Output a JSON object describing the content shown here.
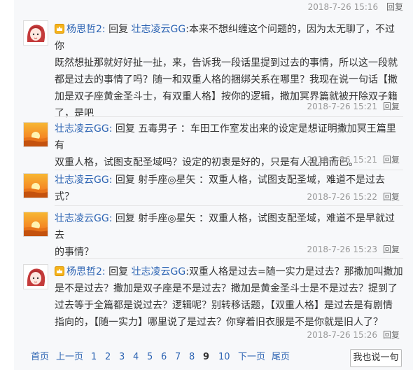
{
  "top_meta": {
    "time": "2018-7-26 15:16",
    "reply_label": "回复"
  },
  "replies": [
    {
      "user": "杨思哲2:",
      "reply_word": "回复",
      "target": "壮志凌云GG",
      "text_lines": [
        ":本来不想纠缠这个问题的，因为太无聊了，不过你",
        "既然想扯那就好好扯一扯，来，告诉我一段话里提到过去的事情，所以这一段就",
        "都是过去的事情了吗？随一和双重人格的捆绑关系在哪里？我现在说一句话【撒",
        "加是双子座黄金圣斗士，有双重人格】按你的逻辑，撒加冥界篇就被开除双子籍",
        "了，是吧"
      ],
      "time": "2018-7-26 15:21",
      "reply_label": "回复"
    },
    {
      "user": "壮志凌云GG:",
      "reply_word": "回复",
      "target": "五毒男子",
      "text_lines": [
        "：车田工作室发出来的设定是想证明撒加冥王篇里有",
        "双重人格，试图支配圣域吗？设定的初衷是好的，只是有人乱用而已。"
      ],
      "time": "2018-7-26 15:21",
      "reply_label": "回复"
    },
    {
      "user": "壮志凌云GG:",
      "reply_word": "回复",
      "target": "射手座◎星矢",
      "text_lines": [
        "：双重人格，试图支配圣域，难道不是过去式？"
      ],
      "time": "2018-7-26 15:22",
      "reply_label": "回复"
    },
    {
      "user": "壮志凌云GG:",
      "reply_word": "回复",
      "target": "射手座◎星矢",
      "text_lines": [
        "：双重人格，试图支配圣域，难道不是早就过去",
        "的事情？"
      ],
      "time": "2018-7-26 15:23",
      "reply_label": "回复"
    },
    {
      "user": "杨思哲2:",
      "reply_word": "回复",
      "target": "壮志凌云GG",
      "text_lines": [
        ":双重人格是过去=随一实力是过去？那撒加叫撒加",
        "是不是过去？撒加是双子座是不是过去？撒加是黄金圣斗士是不是过去？提到了",
        "过去等于全篇都是说过去？逻辑呢？别转移话题，【双重人格】是过去是有剧情",
        "指向的，【随一实力】哪里说了是过去？你穿着旧衣服是不是你就是旧人了？"
      ],
      "time": "2018-7-26 15:26",
      "reply_label": "回复"
    }
  ],
  "pager": {
    "first": "首页",
    "prev": "上一页",
    "pages": [
      "1",
      "2",
      "3",
      "4",
      "5",
      "6",
      "7",
      "8",
      "9",
      "10"
    ],
    "current": "9",
    "next": "下一页",
    "last": "尾页",
    "say_button": "我也说一句"
  }
}
